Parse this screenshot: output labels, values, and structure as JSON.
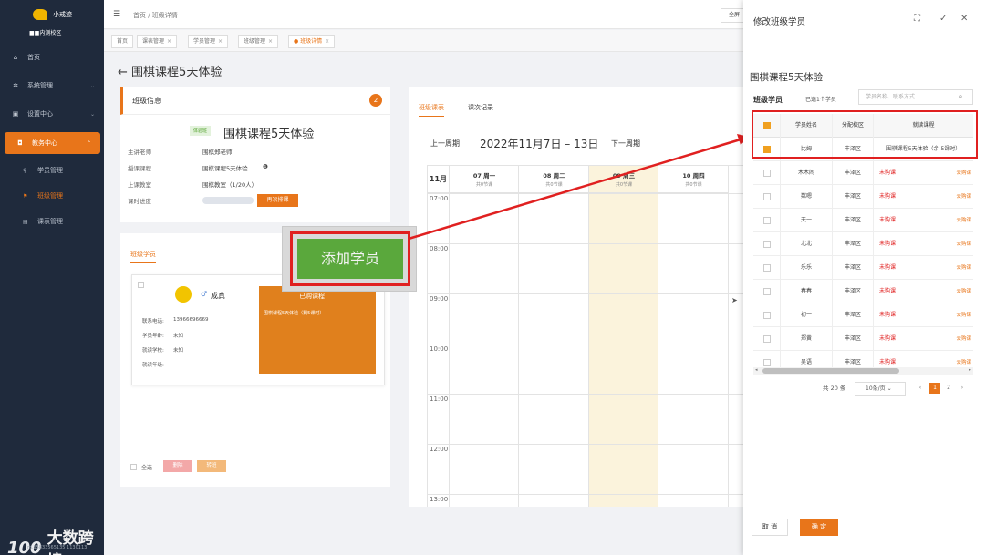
{
  "sidebar": {
    "logo_name": "小戒迹",
    "school_name": "■■内测校区",
    "items": [
      {
        "label": "首页",
        "icon": "home-icon"
      },
      {
        "label": "系统管理",
        "icon": "gear-icon"
      },
      {
        "label": "设置中心",
        "icon": "settings-icon"
      },
      {
        "label": "教务中心",
        "icon": "education-icon"
      }
    ],
    "sub_items": [
      {
        "label": "学员管理"
      },
      {
        "label": "班级管理"
      },
      {
        "label": "课表管理"
      }
    ],
    "brand_logo": "100",
    "brand_text": "大数跨境",
    "brand_phone": "m.15833565135 1130113"
  },
  "topbar": {
    "breadcrumb": "首页 / 班级详情",
    "right_button": "全屏"
  },
  "tabs": [
    {
      "label": "首页"
    },
    {
      "label": "课表管理"
    },
    {
      "label": "学员管理"
    },
    {
      "label": "班级管理"
    },
    {
      "label": "班级详情"
    }
  ],
  "page": {
    "title": "围棋课程5天体验",
    "back": "←"
  },
  "class_info": {
    "heading": "班级信息",
    "edit": "2",
    "tag": "体验班",
    "course_name": "围棋课程5天体验",
    "labels": [
      "主讲老师",
      "授课课程",
      "上课教室",
      "课时进度"
    ],
    "values": [
      "围棋郑老师",
      "围棋课程5天体验",
      "围棋教室（1/20人）"
    ],
    "schedule_button": "再次排课"
  },
  "students_panel": {
    "tab": "班级学员",
    "student": {
      "gender": "♂",
      "name": "成真",
      "labels": [
        "联系电话:",
        "学员年龄:",
        "就读学校:",
        "就读年级:"
      ],
      "values": [
        "13966696669",
        "未知",
        "未知",
        ""
      ],
      "bought_heading": "已购课程",
      "bought_course": "围棋课程5天体验（剩5课时）"
    },
    "select_all": "全选",
    "btn1": "删除",
    "btn2": "转班"
  },
  "schedule": {
    "tabs": [
      "班级课表",
      "课次记录"
    ],
    "prev": "上一周期",
    "week": "2022年11月7日 – 13日",
    "next": "下一周期",
    "month": "11月",
    "days": [
      {
        "date": "07 周一",
        "note": "共0节课"
      },
      {
        "date": "08 周二",
        "note": "共0节课"
      },
      {
        "date": "09 周三",
        "note": "共0节课"
      },
      {
        "date": "10 周四",
        "note": "共0节课"
      }
    ],
    "hours": [
      "07:00",
      "08:00",
      "09:00",
      "10:00",
      "11:00",
      "12:00",
      "13:00"
    ]
  },
  "add_student_button": "添加学员",
  "drawer": {
    "title": "修改班级学员",
    "course": "围棋课程5天体验",
    "label": "班级学员",
    "selected": "已选1个学员",
    "search_placeholder": "学员名称、联系方式",
    "headers": [
      "学员姓名",
      "分配校区",
      "就读课程"
    ],
    "rows": [
      {
        "name": "比姆",
        "campus": "丰泽区",
        "course": "围棋课程5天体验（余 5课时）",
        "checked": true,
        "unbought": false
      },
      {
        "name": "木木闹",
        "campus": "丰泽区",
        "course": "未购课",
        "checked": false,
        "unbought": true
      },
      {
        "name": "粼嗯",
        "campus": "丰泽区",
        "course": "未购课",
        "checked": false,
        "unbought": true
      },
      {
        "name": "天一",
        "campus": "丰泽区",
        "course": "未购课",
        "checked": false,
        "unbought": true
      },
      {
        "name": "北北",
        "campus": "丰泽区",
        "course": "未购课",
        "checked": false,
        "unbought": true
      },
      {
        "name": "乐乐",
        "campus": "丰泽区",
        "course": "未购课",
        "checked": false,
        "unbought": true
      },
      {
        "name": "春春",
        "campus": "丰泽区",
        "course": "未购课",
        "checked": false,
        "unbought": true
      },
      {
        "name": "初一",
        "campus": "丰泽区",
        "course": "未购课",
        "checked": false,
        "unbought": true
      },
      {
        "name": "郑黄",
        "campus": "丰泽区",
        "course": "未购课",
        "checked": false,
        "unbought": true
      },
      {
        "name": "吴语",
        "campus": "丰泽区",
        "course": "未购课",
        "checked": false,
        "unbought": true
      }
    ],
    "buy_link": "去购课",
    "total": "共 20 条",
    "page_size": "10条/页",
    "pages": [
      "1",
      "2"
    ],
    "cancel": "取 消",
    "confirm": "确 定"
  }
}
